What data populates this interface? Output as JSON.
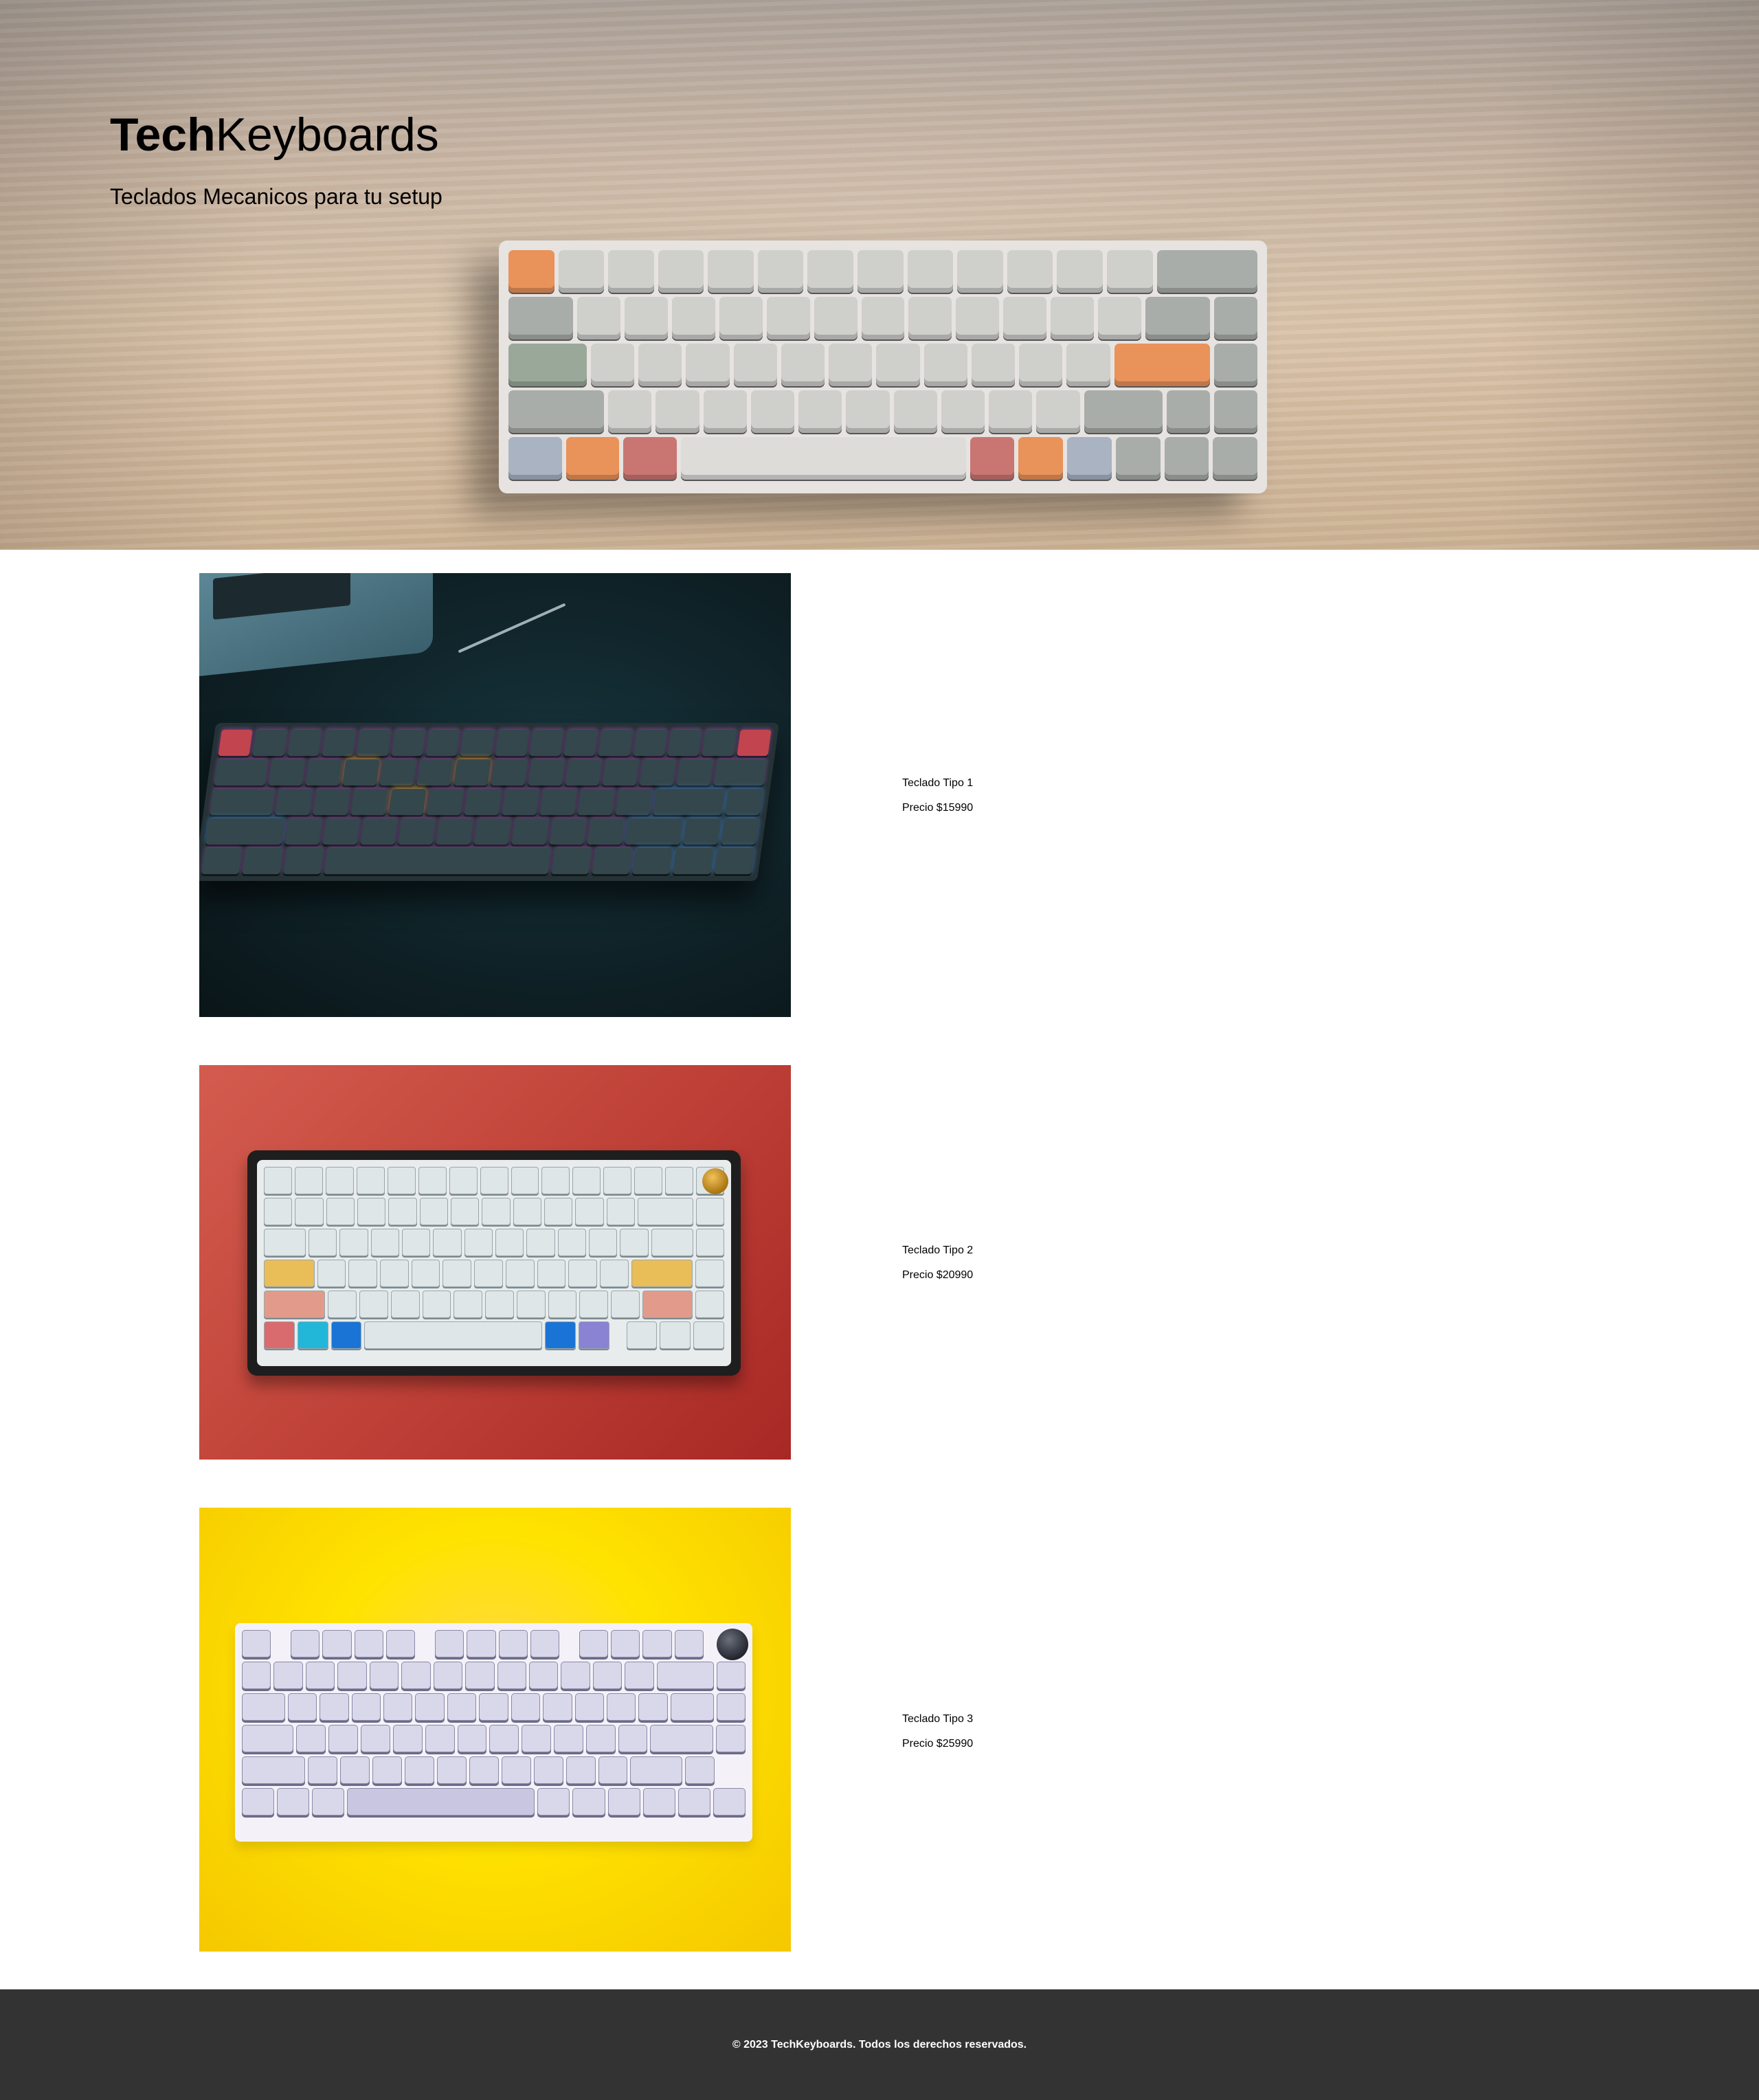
{
  "header": {
    "brand_bold": "Tech",
    "brand_light": "Keyboards",
    "tagline": "Teclados Mecanicos para tu setup"
  },
  "products": [
    {
      "name": "Teclado Tipo 1",
      "price": "Precio $15990"
    },
    {
      "name": "Teclado Tipo 2",
      "price": "Precio $20990"
    },
    {
      "name": "Teclado Tipo 3",
      "price": "Precio $25990"
    }
  ],
  "footer": {
    "text": "© 2023 TechKeyboards. Todos los derechos reservados."
  },
  "colors": {
    "footer_bg": "#333333",
    "footer_text": "#ffffff",
    "product2_bg": "#c4473c",
    "product3_bg": "#ffe300"
  }
}
